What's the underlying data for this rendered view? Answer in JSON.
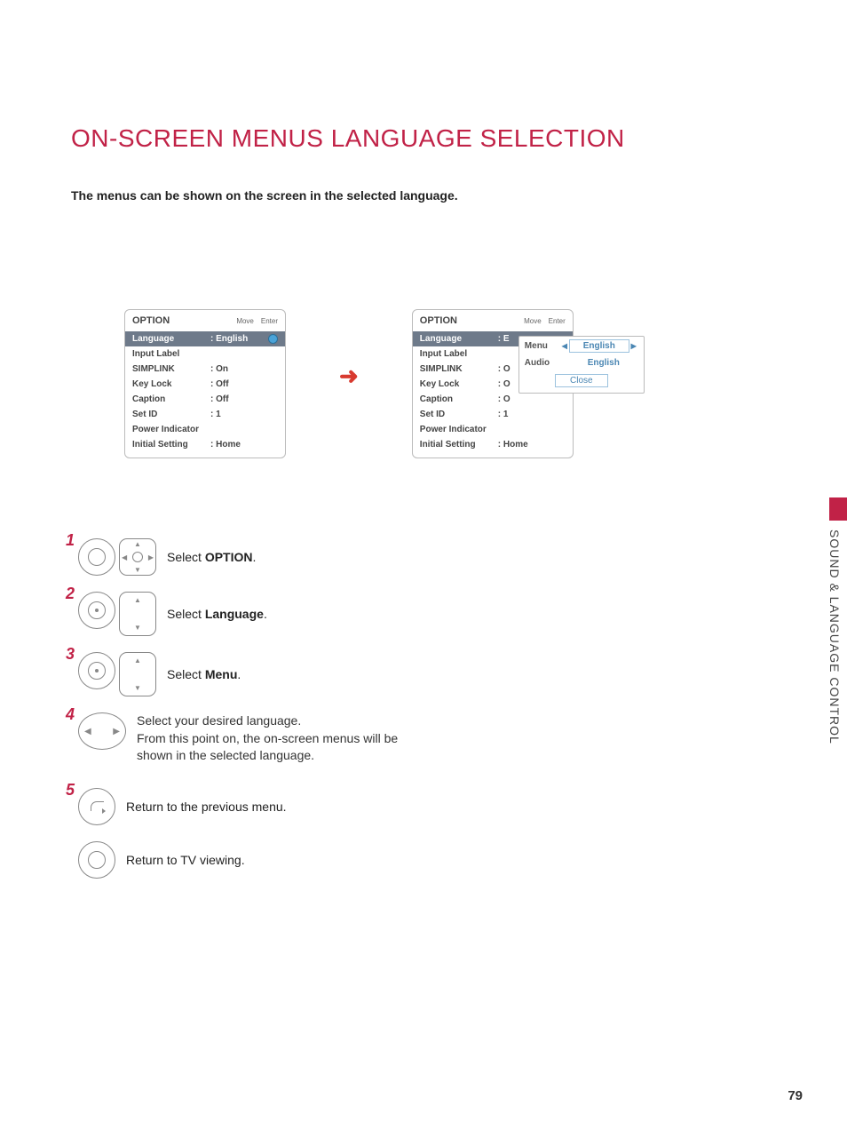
{
  "title": "ON-SCREEN MENUS LANGUAGE SELECTION",
  "intro": "The menus can be shown on the screen in the selected language.",
  "osd": {
    "header": "OPTION",
    "hint_move": "Move",
    "hint_enter": "Enter",
    "rows": [
      {
        "k": "Language",
        "v": ": English",
        "sel": true
      },
      {
        "k": "Input Label",
        "v": ""
      },
      {
        "k": "SIMPLINK",
        "v": ": On"
      },
      {
        "k": "Key Lock",
        "v": ": Off"
      },
      {
        "k": "Caption",
        "v": ": Off"
      },
      {
        "k": "Set ID",
        "v": ": 1"
      },
      {
        "k": "Power Indicator",
        "v": ""
      },
      {
        "k": "Initial Setting",
        "v": ": Home"
      }
    ]
  },
  "osd2": {
    "header": "OPTION",
    "hint_move": "Move",
    "hint_enter": "Enter",
    "rows": [
      {
        "k": "Language",
        "v": ": E",
        "sel": true
      },
      {
        "k": "Input Label",
        "v": ""
      },
      {
        "k": "SIMPLINK",
        "v": ": O"
      },
      {
        "k": "Key Lock",
        "v": ": O"
      },
      {
        "k": "Caption",
        "v": ": O"
      },
      {
        "k": "Set ID",
        "v": ": 1"
      },
      {
        "k": "Power Indicator",
        "v": ""
      },
      {
        "k": "Initial Setting",
        "v": ": Home"
      }
    ]
  },
  "popup": {
    "menu_label": "Menu",
    "menu_value": "English",
    "audio_label": "Audio",
    "audio_value": "English",
    "close": "Close"
  },
  "steps": {
    "s1_pre": "Select ",
    "s1_bold": "OPTION",
    "s1_post": ".",
    "s2_pre": "Select ",
    "s2_bold": "Language",
    "s2_post": ".",
    "s3_pre": "Select ",
    "s3_bold": "Menu",
    "s3_post": ".",
    "s4a": "Select your desired language.",
    "s4b": "From this point on, the on-screen menus will be shown in the selected language.",
    "s5": "Return to the previous menu.",
    "s6": "Return to TV viewing."
  },
  "side_label": "SOUND & LANGUAGE CONTROL",
  "page_number": "79"
}
